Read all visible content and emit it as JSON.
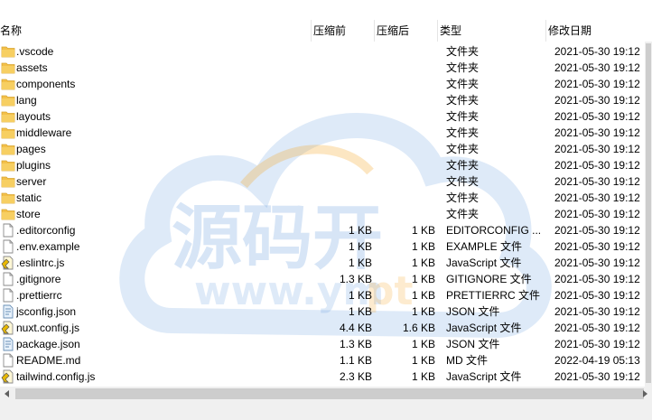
{
  "columns": {
    "name": "名称",
    "compressed": "压缩前",
    "original": "压缩后",
    "type": "类型",
    "modified": "修改日期"
  },
  "files": [
    {
      "name": ".vscode",
      "icon": "folder-icon",
      "compressed": "",
      "original": "",
      "type": "文件夹",
      "modified": "2021-05-30 19:12"
    },
    {
      "name": "assets",
      "icon": "folder-icon",
      "compressed": "",
      "original": "",
      "type": "文件夹",
      "modified": "2021-05-30 19:12"
    },
    {
      "name": "components",
      "icon": "folder-icon",
      "compressed": "",
      "original": "",
      "type": "文件夹",
      "modified": "2021-05-30 19:12"
    },
    {
      "name": "lang",
      "icon": "folder-icon",
      "compressed": "",
      "original": "",
      "type": "文件夹",
      "modified": "2021-05-30 19:12"
    },
    {
      "name": "layouts",
      "icon": "folder-icon",
      "compressed": "",
      "original": "",
      "type": "文件夹",
      "modified": "2021-05-30 19:12"
    },
    {
      "name": "middleware",
      "icon": "folder-icon",
      "compressed": "",
      "original": "",
      "type": "文件夹",
      "modified": "2021-05-30 19:12"
    },
    {
      "name": "pages",
      "icon": "folder-icon",
      "compressed": "",
      "original": "",
      "type": "文件夹",
      "modified": "2021-05-30 19:12"
    },
    {
      "name": "plugins",
      "icon": "folder-icon",
      "compressed": "",
      "original": "",
      "type": "文件夹",
      "modified": "2021-05-30 19:12"
    },
    {
      "name": "server",
      "icon": "folder-icon",
      "compressed": "",
      "original": "",
      "type": "文件夹",
      "modified": "2021-05-30 19:12"
    },
    {
      "name": "static",
      "icon": "folder-icon",
      "compressed": "",
      "original": "",
      "type": "文件夹",
      "modified": "2021-05-30 19:12"
    },
    {
      "name": "store",
      "icon": "folder-icon",
      "compressed": "",
      "original": "",
      "type": "文件夹",
      "modified": "2021-05-30 19:12"
    },
    {
      "name": ".editorconfig",
      "icon": "file-icon",
      "compressed": "1 KB",
      "original": "1 KB",
      "type": "EDITORCONFIG ...",
      "modified": "2021-05-30 19:12"
    },
    {
      "name": ".env.example",
      "icon": "file-icon",
      "compressed": "1 KB",
      "original": "1 KB",
      "type": "EXAMPLE 文件",
      "modified": "2021-05-30 19:12"
    },
    {
      "name": ".eslintrc.js",
      "icon": "js-file-icon",
      "compressed": "1 KB",
      "original": "1 KB",
      "type": "JavaScript 文件",
      "modified": "2021-05-30 19:12"
    },
    {
      "name": ".gitignore",
      "icon": "file-icon",
      "compressed": "1.3 KB",
      "original": "1 KB",
      "type": "GITIGNORE 文件",
      "modified": "2021-05-30 19:12"
    },
    {
      "name": ".prettierrc",
      "icon": "file-icon",
      "compressed": "1 KB",
      "original": "1 KB",
      "type": "PRETTIERRC 文件",
      "modified": "2021-05-30 19:12"
    },
    {
      "name": "jsconfig.json",
      "icon": "json-file-icon",
      "compressed": "1 KB",
      "original": "1 KB",
      "type": "JSON 文件",
      "modified": "2021-05-30 19:12"
    },
    {
      "name": "nuxt.config.js",
      "icon": "js-file-icon",
      "compressed": "4.4 KB",
      "original": "1.6 KB",
      "type": "JavaScript 文件",
      "modified": "2021-05-30 19:12"
    },
    {
      "name": "package.json",
      "icon": "json-file-icon",
      "compressed": "1.3 KB",
      "original": "1 KB",
      "type": "JSON 文件",
      "modified": "2021-05-30 19:12"
    },
    {
      "name": "README.md",
      "icon": "file-icon",
      "compressed": "1.1 KB",
      "original": "1 KB",
      "type": "MD 文件",
      "modified": "2022-04-19 05:13"
    },
    {
      "name": "tailwind.config.js",
      "icon": "js-file-icon",
      "compressed": "2.3 KB",
      "original": "1 KB",
      "type": "JavaScript 文件",
      "modified": "2021-05-30 19:12"
    }
  ],
  "watermark": {
    "title": "源码开",
    "url": "www.ym",
    "url_tail": "pt"
  },
  "colors": {
    "folder": "#f3c04a",
    "watermark": "#4a8ad6",
    "watermark_accent": "#f5a623"
  }
}
